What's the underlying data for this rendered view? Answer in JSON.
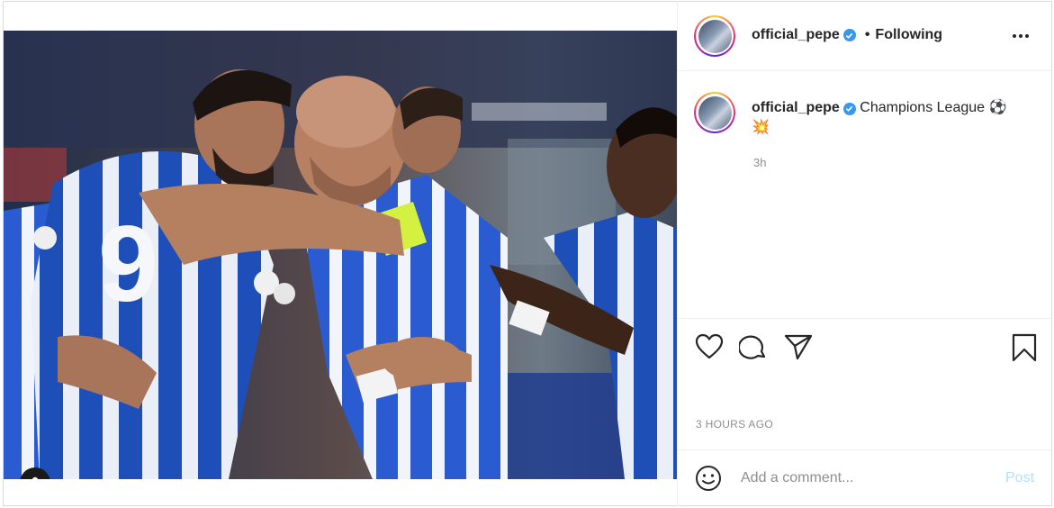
{
  "post": {
    "media_alt": "",
    "user_tag_icon": "person-icon"
  },
  "header": {
    "username": "official_pepe",
    "separator": "•",
    "follow_status": "Following",
    "more_icon": "ellipsis-icon"
  },
  "caption": {
    "username": "official_pepe",
    "text": "Champions League ⚽️",
    "emoji_line": "💥",
    "age": "3h"
  },
  "actions": {
    "icons": [
      "heart-icon",
      "comment-icon",
      "share-icon",
      "bookmark-icon"
    ],
    "posted_ago": "3 HOURS AGO"
  },
  "comment_box": {
    "placeholder": "Add a comment...",
    "post_label": "Post",
    "emoji_icon": "smiley-icon"
  },
  "colors": {
    "verified": "#3897f0",
    "post_disabled": "#b2dffc",
    "text": "#262626",
    "muted": "#8e8e8e"
  }
}
